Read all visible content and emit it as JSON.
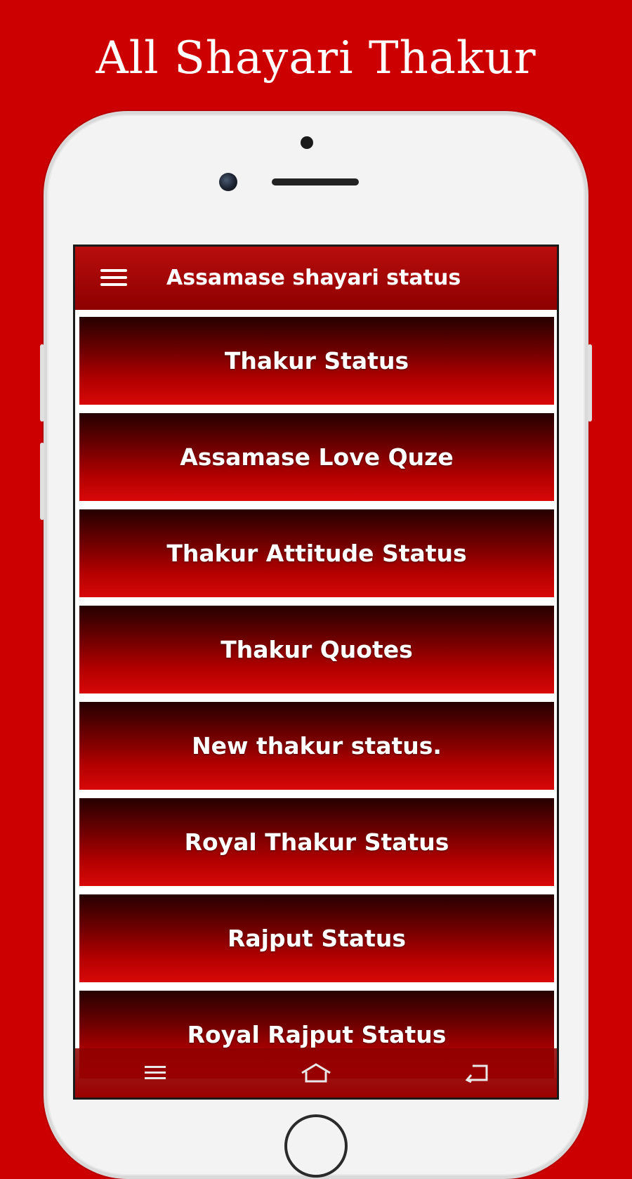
{
  "promo": {
    "title": "All Shayari Thakur"
  },
  "app_bar": {
    "title": "Assamase shayari status",
    "menu_icon": "hamburger-menu-icon"
  },
  "menu": {
    "items": [
      {
        "label": "Thakur Status"
      },
      {
        "label": "Assamase Love Quze"
      },
      {
        "label": "Thakur Attitude Status"
      },
      {
        "label": "Thakur Quotes"
      },
      {
        "label": "New thakur status."
      },
      {
        "label": "Royal Thakur Status"
      },
      {
        "label": "Rajput Status"
      },
      {
        "label": "Royal Rajput Status"
      }
    ]
  },
  "system_nav": {
    "recents_icon": "recent-apps-icon",
    "home_icon": "home-icon",
    "back_icon": "back-icon"
  },
  "colors": {
    "background": "#cc0000",
    "app_bar": "#a00000",
    "item_text": "#ffffff"
  }
}
